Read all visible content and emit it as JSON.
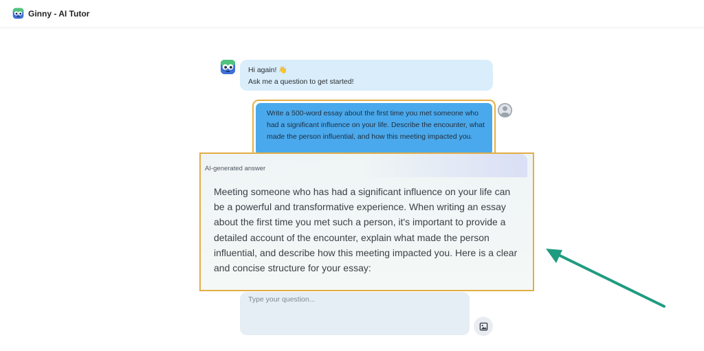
{
  "app": {
    "title": "Ginny - AI Tutor",
    "logo_icon": "robot-face-icon"
  },
  "chat": {
    "greeting_line1": "Hi again!",
    "greeting_emoji": "👋",
    "greeting_line2": "Ask me a question to get started!",
    "user_message": "Write a 500-word essay about the first time you met someone who had a significant influence on your life. Describe the encounter, what made the person influential, and how this meeting impacted you.",
    "answer_label": "AI-generated answer",
    "answer_text": "Meeting someone who has had a significant influence on your life can be a powerful and transformative experience. When writing an essay about the first time you met such a person, it's important to provide a detailed account of the encounter, explain what made the person influential, and describe how this meeting impacted you. Here is a clear and concise structure for your essay:"
  },
  "input": {
    "placeholder": "Type your question..."
  },
  "colors": {
    "highlight_border": "#e2ad45",
    "annotation_arrow": "#1f9b80",
    "user_bubble": "#4aa9ec",
    "bot_bubble": "#d9edfb"
  }
}
